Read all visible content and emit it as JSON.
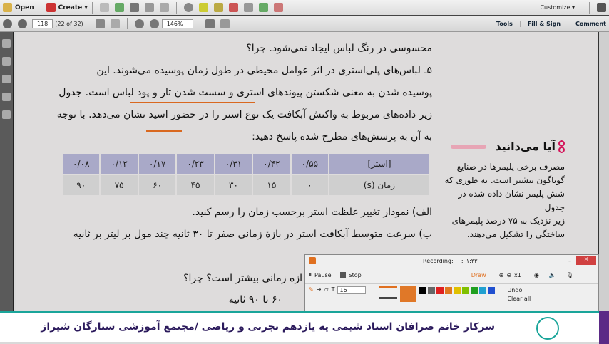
{
  "toolbar": {
    "open": "Open",
    "create": "Create ▾",
    "customize": "Customize ▾",
    "page_number": "118",
    "page_count": "(22 of 32)",
    "zoom": "146%",
    "tools": "Tools",
    "fill_sign": "Fill & Sign",
    "comment": "Comment"
  },
  "document": {
    "lines": [
      "محسوسی در رنگ لباس ایجاد نمی‌شود. چرا؟",
      "۵ـ لباس‌های پلی‌استری در اثر عوامل محیطی در طول زمان پوسیده می‌شوند. این",
      "پوسیده شدن به معنی شکستن پیوندهای استری و سست شدن تار و پود لباس است. جدول",
      "زیر داده‌های مربوط به واکنش آبکافت یک نوع استر را در حضور اسید نشان می‌دهد. با توجه",
      "به آن به پرسش‌های مطرح شده پاسخ دهید:"
    ],
    "table": {
      "row1": [
        "[استر]",
        "۰/۵۵",
        "۰/۴۲",
        "۰/۳۱",
        "۰/۲۳",
        "۰/۱۷",
        "۰/۱۲",
        "۰/۰۸"
      ],
      "row2": [
        "زمان (s)",
        "۰",
        "۱۵",
        "۳۰",
        "۴۵",
        "۶۰",
        "۷۵",
        "۹۰"
      ]
    },
    "q_a": "الف) نمودار تغییر غلظت استر برحسب زمان را رسم کنید.",
    "q_b": "ب) سرعت متوسط آبکافت استر در بازهٔ زمانی صفر تا ۳۰ ثانیه چند مول بر لیتر بر ثانیه",
    "q_c": "ازه زمانی بیشتر است؟ چرا؟",
    "answer": "۶۰ تا ۹۰ ثانیه"
  },
  "sidebox": {
    "title": "آیا می‌دانید",
    "lines": [
      "مصرف برخی پلیمرها در صنایع",
      "گوناگون بیشتر است. به طوری که",
      "شش پلیمر نشان داده شده در جدول",
      "زیر نزدیک به ۷۵ درصد پلیمرهای",
      "ساختگی را تشکیل می‌دهند."
    ]
  },
  "recorder": {
    "title": "Recording: ۰۰:۰۱:۳۳",
    "pause": "Pause",
    "stop": "Stop",
    "draw": "Draw",
    "zoom_level": "x1",
    "font_size": "16",
    "undo": "Undo",
    "clear_all": "Clear all",
    "colors": [
      "#000000",
      "#666666",
      "#e02020",
      "#e07820",
      "#e0c000",
      "#80c000",
      "#20a020",
      "#20a0d0",
      "#2050d0"
    ]
  },
  "banner": {
    "text": "سرکار خانم صرافان استاد شیمی یه یازدهم  تجربی و ریاضی /مجتمع آموزشی ستارگان شیراز"
  }
}
